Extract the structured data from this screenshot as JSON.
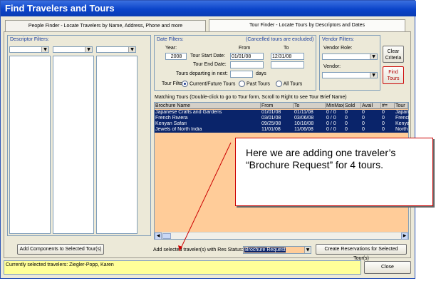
{
  "window": {
    "title": "Find Travelers and Tours"
  },
  "tabs": [
    {
      "label": "People Finder - Locate Travelers by Name, Address, Phone and more"
    },
    {
      "label": "Tour Finder - Locate Tours by Descriptors and Dates"
    }
  ],
  "descriptor_filters": {
    "label": "Descriptor Filters:"
  },
  "date_filters": {
    "label": "Date Filters:",
    "note": "(Cancelled tours are excluded)",
    "year_label": "Year:",
    "year_value": "2008",
    "from_label": "From",
    "to_label": "To",
    "start_label": "Tour Start Date:",
    "start_from": "01/01/08",
    "start_to": "12/31/08",
    "end_label": "Tour End Date:",
    "departing_label": "Tours departing in next:",
    "days_label": "days",
    "filter_label": "Tour Filter",
    "radio_current": "Current/Future Tours",
    "radio_past": "Past Tours",
    "radio_all": "All Tours"
  },
  "vendor_filters": {
    "label": "Vendor Filters:",
    "role_label": "Vendor Role:",
    "vendor_label": "Vendor:"
  },
  "buttons": {
    "clear_line1": "Clear",
    "clear_line2": "Criteria",
    "find_line1": "Find",
    "find_line2": "Tours",
    "add_components": "Add Components to Selected Tour(s)",
    "create_reservations": "Create Reservations for Selected Tour(s)",
    "close": "Close"
  },
  "matching": {
    "label": "Matching Tours (Double-click to go to Tour form, Scroll to Right to see Tour Brief Name)",
    "columns": [
      "Brochure Name",
      "From",
      "To",
      "MinMax",
      "Sold",
      "Avail",
      "#=",
      "Tour N"
    ],
    "rows": [
      [
        "Japanese Crafts and Gardens",
        "01/01/08",
        "01/11/08",
        "0 / 0",
        "0",
        "0",
        "0",
        "Japan"
      ],
      [
        "French Riviera",
        "03/01/08",
        "03/06/08",
        "0 / 0",
        "0",
        "0",
        "0",
        "French"
      ],
      [
        "Kenyan Safari",
        "09/25/08",
        "10/10/08",
        "0 / 0",
        "0",
        "0",
        "0",
        "Kenya"
      ],
      [
        "Jewels of North India",
        "11/01/08",
        "11/06/08",
        "0 / 0",
        "0",
        "0",
        "0",
        "North"
      ]
    ]
  },
  "res_status": {
    "label": "Add selected traveler(s) with Res Status:",
    "value": "Brochure Request"
  },
  "status_bar": {
    "text": "Currently selected travelers: Ziegler-Popp, Karen"
  },
  "callout": {
    "text": "Here we are adding one traveler’s “Brochure Request” for 4 tours."
  }
}
